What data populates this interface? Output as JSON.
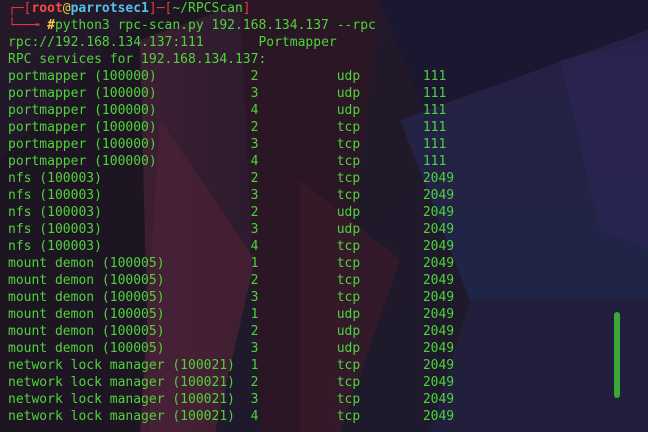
{
  "prompt": {
    "top_frame": "┌─[",
    "user": "root",
    "at": "@",
    "host": "parrotsec1",
    "mid_frame": "]─[",
    "path": "~/RPCScan",
    "close_frame": "]",
    "bottom_frame": "└──╼",
    "hash": " #",
    "command": "python3 rpc-scan.py 192.168.134.137 --rpc"
  },
  "output": {
    "url_line": {
      "url": "rpc://192.168.134.137:111",
      "service": "Portmapper"
    },
    "header": "RPC services for 192.168.134.137:",
    "rows": [
      {
        "name": "portmapper (100000)",
        "version": "2",
        "proto": "udp",
        "port": "111"
      },
      {
        "name": "portmapper (100000)",
        "version": "3",
        "proto": "udp",
        "port": "111"
      },
      {
        "name": "portmapper (100000)",
        "version": "4",
        "proto": "udp",
        "port": "111"
      },
      {
        "name": "portmapper (100000)",
        "version": "2",
        "proto": "tcp",
        "port": "111"
      },
      {
        "name": "portmapper (100000)",
        "version": "3",
        "proto": "tcp",
        "port": "111"
      },
      {
        "name": "portmapper (100000)",
        "version": "4",
        "proto": "tcp",
        "port": "111"
      },
      {
        "name": "nfs (100003)",
        "version": "2",
        "proto": "tcp",
        "port": "2049"
      },
      {
        "name": "nfs (100003)",
        "version": "3",
        "proto": "tcp",
        "port": "2049"
      },
      {
        "name": "nfs (100003)",
        "version": "2",
        "proto": "udp",
        "port": "2049"
      },
      {
        "name": "nfs (100003)",
        "version": "3",
        "proto": "udp",
        "port": "2049"
      },
      {
        "name": "nfs (100003)",
        "version": "4",
        "proto": "tcp",
        "port": "2049"
      },
      {
        "name": "mount demon (100005)",
        "version": "1",
        "proto": "tcp",
        "port": "2049"
      },
      {
        "name": "mount demon (100005)",
        "version": "2",
        "proto": "tcp",
        "port": "2049"
      },
      {
        "name": "mount demon (100005)",
        "version": "3",
        "proto": "tcp",
        "port": "2049"
      },
      {
        "name": "mount demon (100005)",
        "version": "1",
        "proto": "udp",
        "port": "2049"
      },
      {
        "name": "mount demon (100005)",
        "version": "2",
        "proto": "udp",
        "port": "2049"
      },
      {
        "name": "mount demon (100005)",
        "version": "3",
        "proto": "udp",
        "port": "2049"
      },
      {
        "name": "network lock manager (100021)",
        "version": "1",
        "proto": "tcp",
        "port": "2049"
      },
      {
        "name": "network lock manager (100021)",
        "version": "2",
        "proto": "tcp",
        "port": "2049"
      },
      {
        "name": "network lock manager (100021)",
        "version": "3",
        "proto": "tcp",
        "port": "2049"
      },
      {
        "name": "network lock manager (100021)",
        "version": "4",
        "proto": "tcp",
        "port": "2049"
      }
    ]
  },
  "colors": {
    "output_text": "#4fd33a",
    "prompt_user": "#ff4747",
    "prompt_host": "#4fc3e8",
    "prompt_frame": "#e03b3b",
    "prompt_at": "#f2d13b",
    "scrollbar": "#3ca63a"
  }
}
